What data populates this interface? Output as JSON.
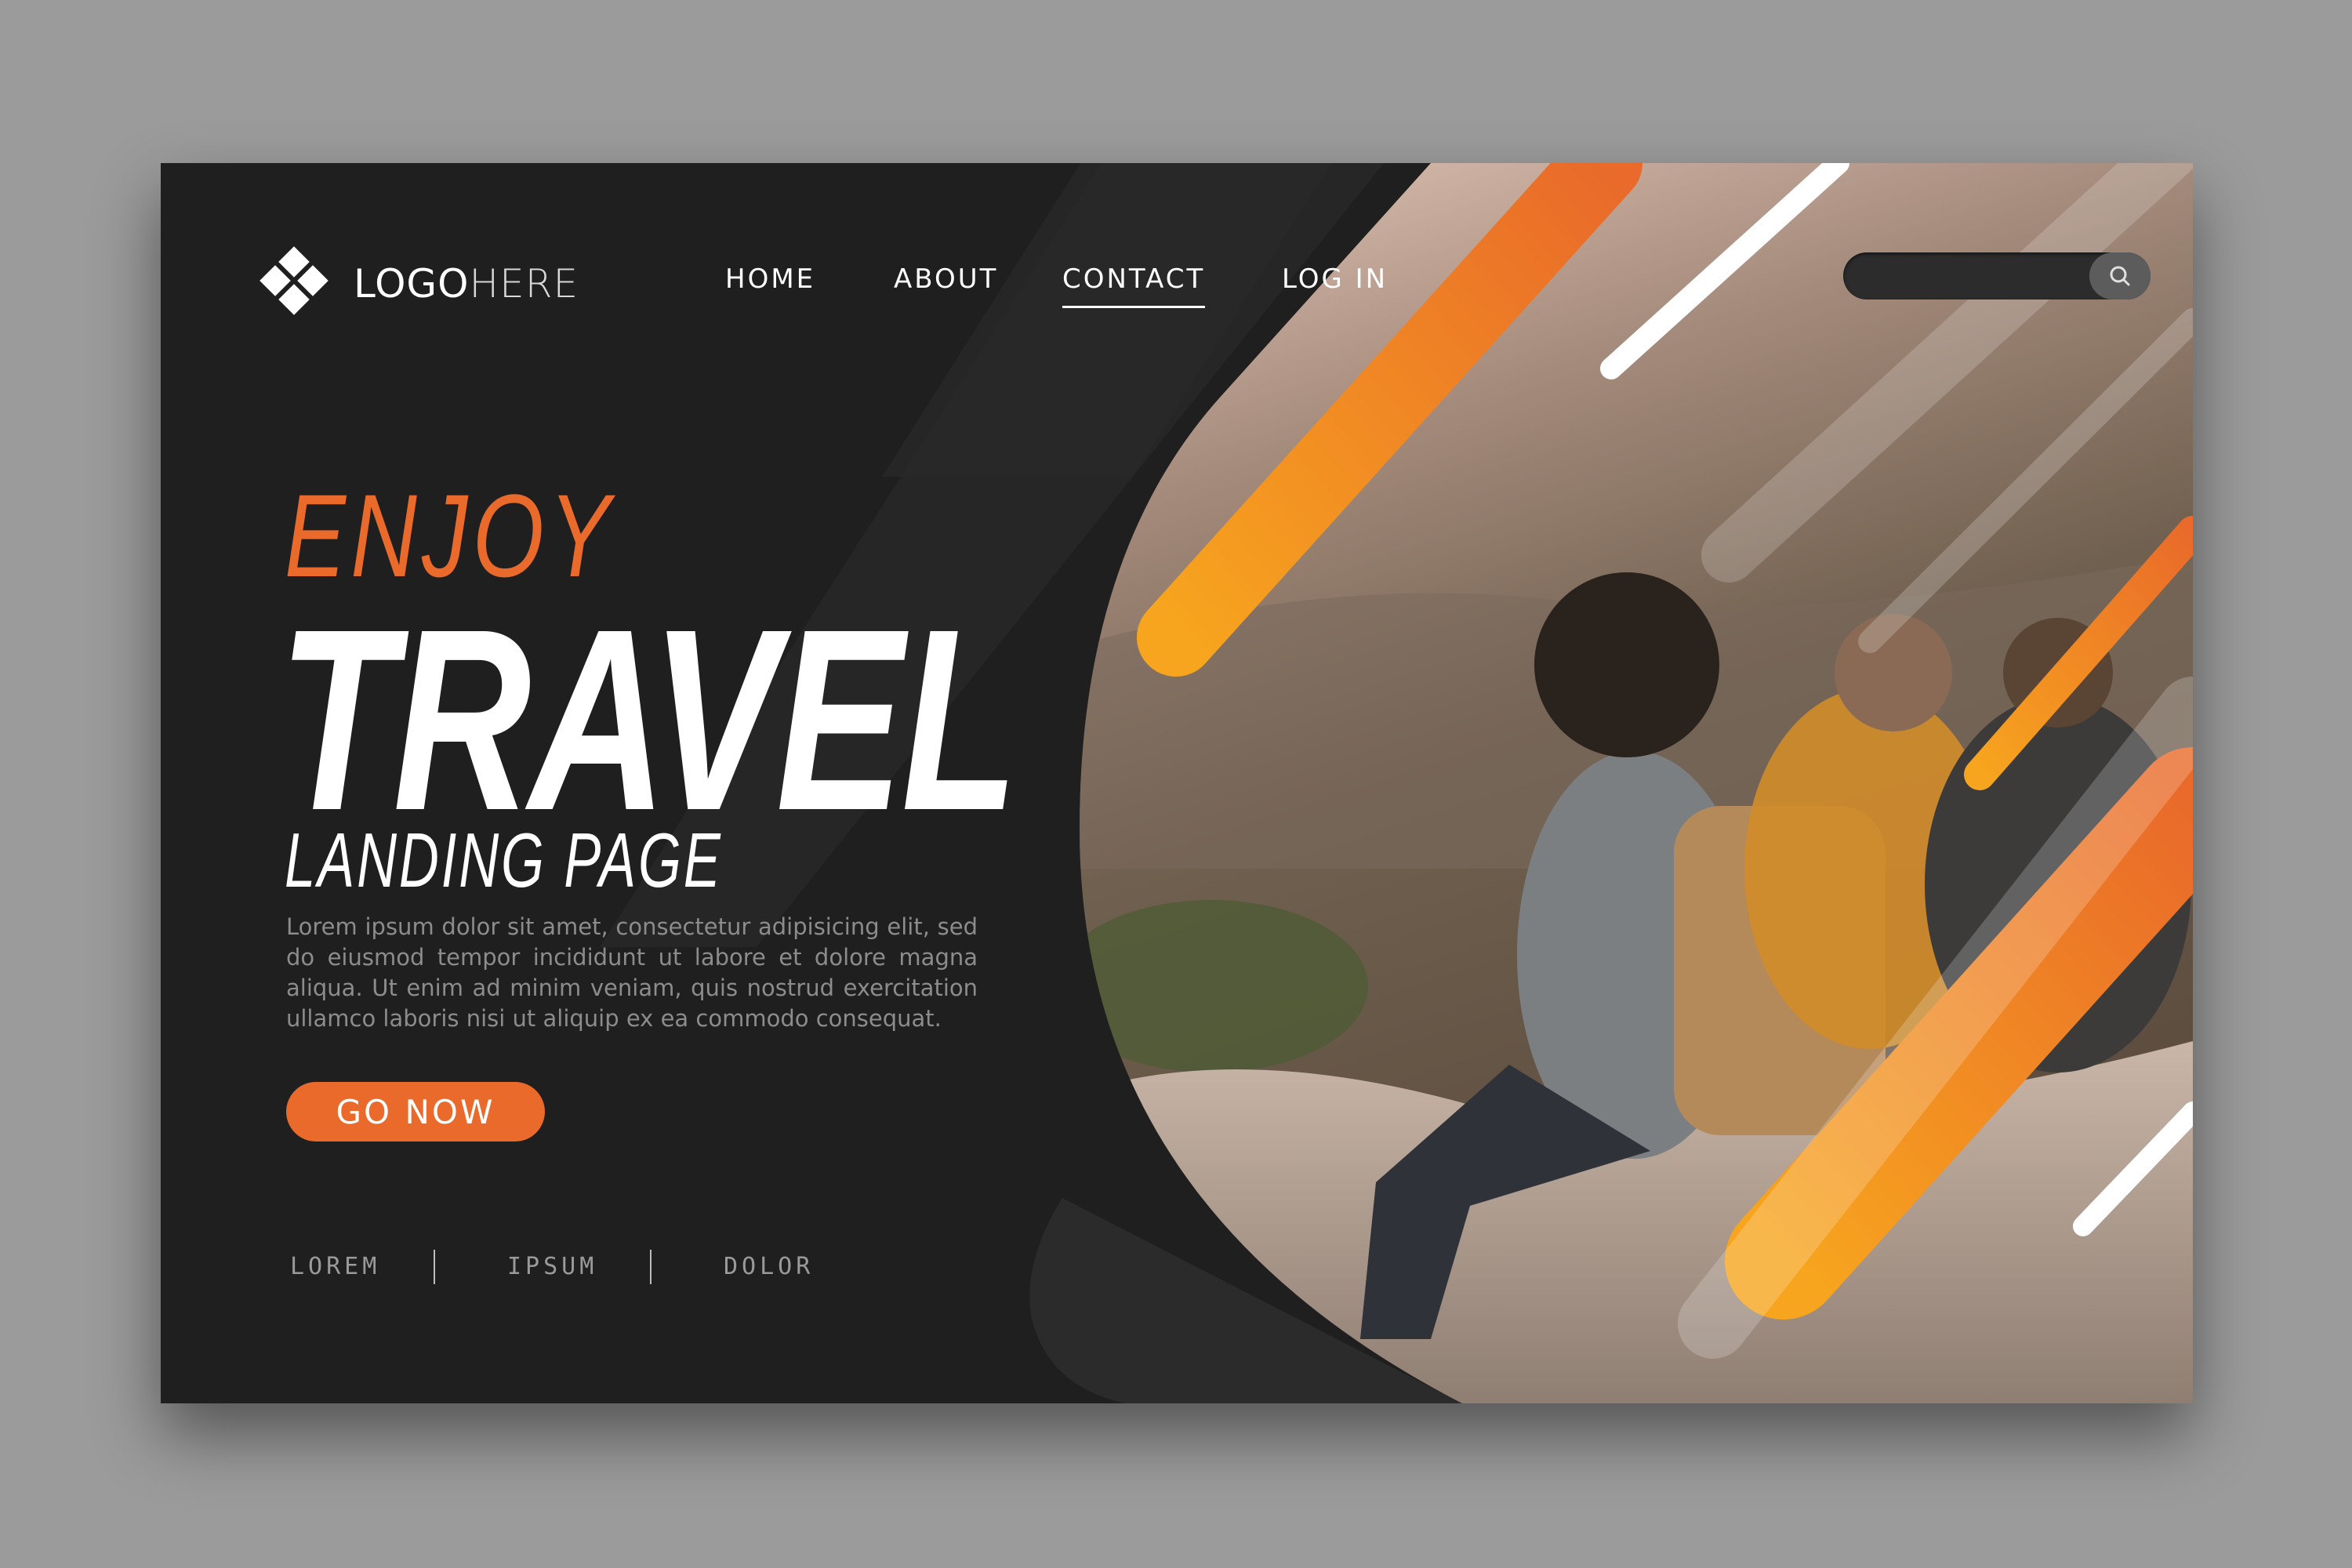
{
  "brand": {
    "logo_strong": "LOGO",
    "logo_light": "HERE"
  },
  "nav": {
    "items": [
      {
        "label": "HOME"
      },
      {
        "label": "ABOUT"
      },
      {
        "label": "CONTACT",
        "active": true
      },
      {
        "label": "LOG IN"
      }
    ]
  },
  "search": {
    "placeholder": "",
    "icon": "search-icon"
  },
  "hero": {
    "kicker": "ENJOY",
    "title": "TRAVEL",
    "subtitle": "LANDING PAGE",
    "body": "Lorem ipsum dolor sit amet, consectetur adipisicing elit, sed do eiusmod tempor incididunt ut labore et dolore magna aliqua. Ut enim ad minim veniam, quis nostrud exercitation ullamco laboris nisi ut aliquip ex ea commodo consequat.",
    "cta_label": "GO NOW"
  },
  "footer": {
    "links": [
      "LOREM",
      "IPSUM",
      "DOLOR"
    ]
  },
  "colors": {
    "accent": "#e96a2a",
    "accent_yellow": "#f7a51e",
    "card_background": "#1f1f1f",
    "page_background": "#9c9b9c"
  }
}
